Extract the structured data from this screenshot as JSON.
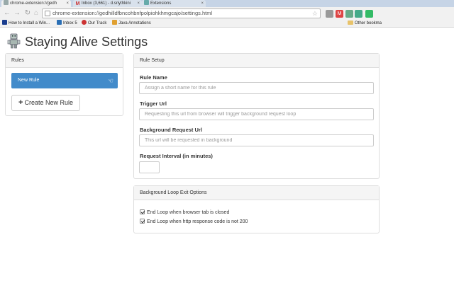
{
  "browser": {
    "tabs": [
      {
        "title": "chrome-extension://gedh",
        "close": "×"
      },
      {
        "title": "Inbox (3,661) - d.sriythkini",
        "close": "×"
      },
      {
        "title": "Extensions",
        "close": "×"
      }
    ],
    "url": "chrome-extension://gedhilldfbncohbnfpolpiohkhmgcajo/settings.html",
    "bookmarks": [
      {
        "label": "How to Install a Win..."
      },
      {
        "label": "Inbox 5"
      },
      {
        "label": "Our Track"
      },
      {
        "label": "Java Annotations"
      }
    ],
    "other_bookmarks": "Other bookma",
    "colors": {
      "tabstrip": "#c6d4e6",
      "toolbar": "#f1f1f1"
    }
  },
  "page": {
    "title": "Staying Alive Settings",
    "rules_panel": {
      "heading": "Rules",
      "items": [
        {
          "label": "New Rule",
          "icon": "hand-pointer-icon"
        }
      ],
      "create_button": "Create New Rule"
    },
    "rule_setup": {
      "heading": "Rule Setup",
      "rule_name": {
        "label": "Rule Name",
        "placeholder": "Assign a short name for this rule",
        "value": ""
      },
      "trigger_url": {
        "label": "Trigger Url",
        "placeholder": "Requesting this url from browser will trigger background request loop",
        "value": ""
      },
      "background_url": {
        "label": "Background Request Url",
        "placeholder": "This url will be requested in background",
        "value": ""
      },
      "interval": {
        "label": "Request Interval (in minutes)",
        "value": ""
      }
    },
    "exit_options": {
      "heading": "Background Loop Exit Options",
      "options": [
        {
          "label": "End Loop when browser tab is closed",
          "checked": true
        },
        {
          "label": "End Loop when http response code is not 200",
          "checked": true
        }
      ]
    },
    "colors": {
      "primary": "#428bca",
      "panel_heading": "#f5f5f5",
      "border": "#dddddd"
    }
  }
}
